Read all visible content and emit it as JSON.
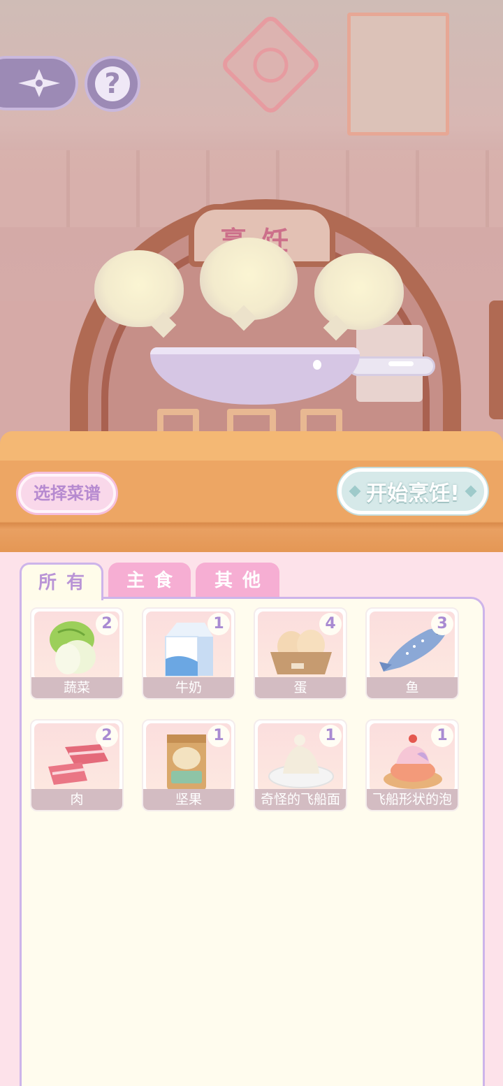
{
  "scene": {
    "sign_text": "烹饪"
  },
  "top_buttons": {
    "back_icon": "four-point-star-arrow-icon",
    "help_icon": "question-icon",
    "help_glyph": "?"
  },
  "actions": {
    "select_recipe_label": "选择菜谱",
    "start_cooking_label": "开始烹饪!"
  },
  "tabs": [
    {
      "label": "所有",
      "active": true
    },
    {
      "label": "主食",
      "active": false
    },
    {
      "label": "其他",
      "active": false
    }
  ],
  "ingredients": [
    {
      "name": "蔬菜",
      "count": "2",
      "icon": "cabbage-icon"
    },
    {
      "name": "牛奶",
      "count": "1",
      "icon": "milk-carton-icon"
    },
    {
      "name": "蛋",
      "count": "4",
      "icon": "eggs-icon"
    },
    {
      "name": "鱼",
      "count": "3",
      "icon": "fish-icon"
    },
    {
      "name": "肉",
      "count": "2",
      "icon": "meat-icon"
    },
    {
      "name": "坚果",
      "count": "1",
      "icon": "nuts-bag-icon"
    },
    {
      "name": "奇怪的飞船面",
      "count": "1",
      "icon": "cream-dish-icon"
    },
    {
      "name": "飞船形状的泡",
      "count": "1",
      "icon": "cream-puff-icon"
    }
  ],
  "colors": {
    "accent_purple": "#b994d6",
    "tab_pink": "#f6aed3",
    "counter_orange": "#eda664",
    "panel_bg": "#fffcee"
  }
}
